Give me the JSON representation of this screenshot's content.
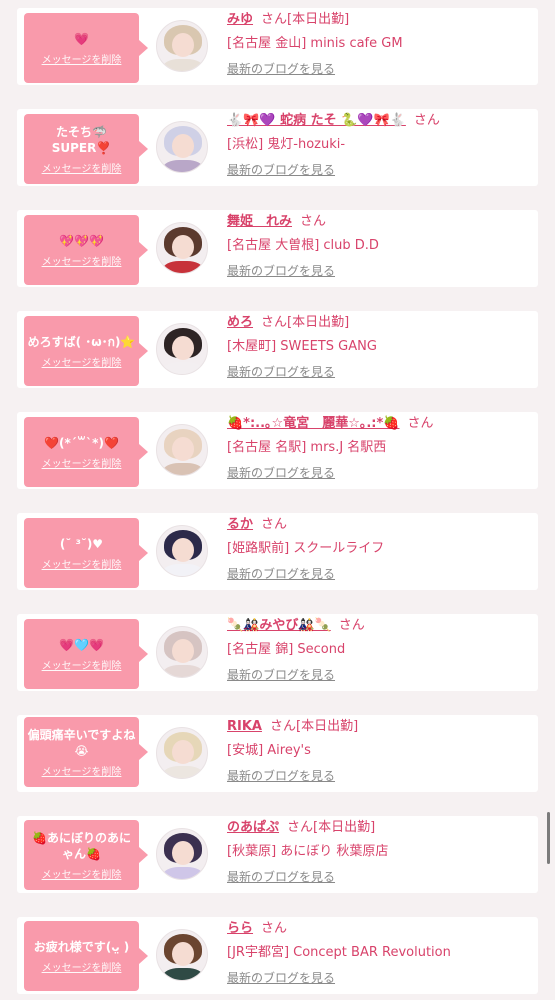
{
  "delete_label": "メッセージを削除",
  "san_label": "さん",
  "blog_label": "最新のブログを見る",
  "entries": [
    {
      "message": "💗",
      "name": "みゆ",
      "shift": "[本日出勤]",
      "shop": "[名古屋 金山] minis cafe GM"
    },
    {
      "message": "たそち🦈\nSUPER❣️",
      "name": "🐇🎀💜 蛇病 たそ 🐍💜🎀🐇",
      "shift": "",
      "shop": "[浜松] 鬼灯-hozuki-"
    },
    {
      "message": "💖💖💖",
      "name": "舞姫　れみ",
      "shift": "",
      "shop": "[名古屋 大曽根] club D.D"
    },
    {
      "message": "めろすば( ･ω･ก)⭐️",
      "name": "めろ",
      "shift": "[本日出勤]",
      "shop": "[木屋町] SWEETS GANG"
    },
    {
      "message": "❤️(*´꒳`*)❤️",
      "name": "🍓*:..｡☆竜宮　麗華☆｡.:*🍓",
      "shift": "",
      "shop": "[名古屋 名駅] mrs.J 名駅西"
    },
    {
      "message": "(˘ ³˘)♥",
      "name": "るか",
      "shift": "",
      "shop": "[姫路駅前] スクールライフ"
    },
    {
      "message": "💗🩵💗",
      "name": "🍡🎎みやび🎎🍡",
      "shift": "",
      "shop": "[名古屋 錦] Second"
    },
    {
      "message": "偏頭痛辛いですよね😭",
      "name": "RIKA",
      "shift": "[本日出勤]",
      "shop": "[安城] Airey's"
    },
    {
      "message": "🍓あにぼりのあにゃん🍓",
      "name": "のあぱぷ",
      "shift": "[本日出勤]",
      "shop": "[秋葉原] あにぼり 秋葉原店"
    },
    {
      "message": "お疲れ様です(ᴗ̤ )",
      "name": "らら",
      "shift": "",
      "shop": "[JR宇都宮] Concept BAR Revolution"
    }
  ],
  "avatar_colors": [
    {
      "hair": "#d9c7b0",
      "body": "#e8e0d8"
    },
    {
      "hair": "#cfd0e6",
      "body": "#b9a7c8"
    },
    {
      "hair": "#5b3a2e",
      "body": "#c7323a"
    },
    {
      "hair": "#2d2424",
      "body": "#f3eff1"
    },
    {
      "hair": "#e8d3c0",
      "body": "#d9c2b4"
    },
    {
      "hair": "#2c2a4a",
      "body": "#f2f2f7"
    },
    {
      "hair": "#d6c4c2",
      "body": "#e5d8d6"
    },
    {
      "hair": "#e6d7b8",
      "body": "#ece6e0"
    },
    {
      "hair": "#3b3050",
      "body": "#cfc6e8"
    },
    {
      "hair": "#6b4530",
      "body": "#2f4a45"
    }
  ]
}
